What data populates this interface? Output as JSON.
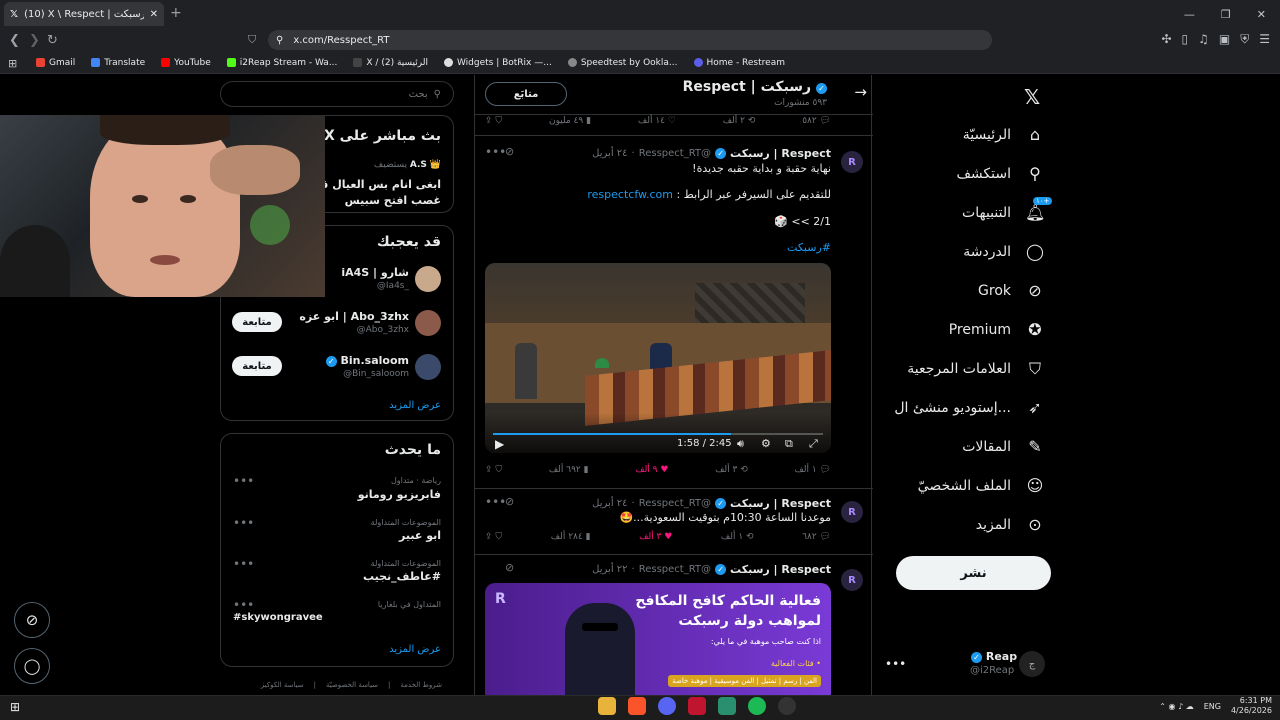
{
  "browser": {
    "tab_title": "(10) X \\ Respect | رسبكت (@Resp",
    "url": "x.com/Resspect_RT",
    "bookmarks": [
      "Gmail",
      "Translate",
      "YouTube",
      "i2Reap Stream - Wa...",
      "X / الرئيسية (2)",
      "Widgets | BotRix —...",
      "Speedtest by Ookla...",
      "Home - Restream"
    ]
  },
  "nav": {
    "home": "الرئيسيّة",
    "explore": "استكشف",
    "notifications": "التنبيهات",
    "notif_badge": "١٠+",
    "chat": "الدردشة",
    "grok": "Grok",
    "premium": "Premium",
    "bookmarks": "العلامات المرجعية",
    "studio": "إستوديو منشئ ال...",
    "articles": "المقالات",
    "profile": "الملف الشخصيّ",
    "more": "المزيد",
    "post": "نشر",
    "account_name": "Reap",
    "account_handle": "@i2Reap"
  },
  "profile": {
    "name": "Respect | رسبكت",
    "post_count": "٥٩٣ منشورات",
    "follow_label": "متابَع"
  },
  "tweets": [
    {
      "name": "Respect | رسبكت",
      "handle": "@Resspect_RT",
      "date": "٢٤ أبريل",
      "line1": "نهاية حقبة و بداية حقبه جديدة!",
      "line2": "للتقديم على السيرفر عبر الرابط :",
      "link": "respectcfw.com",
      "line3": "2/1 >> 🎲",
      "hashtag": "#رسبكت",
      "video_time": "1:58 / 2:45",
      "replies": "١ ألف",
      "reposts": "٣ ألف",
      "likes": "٩ ألف",
      "views": "٦٩٢ ألف"
    },
    {
      "name": "Respect | رسبكت",
      "handle": "@Resspect_RT",
      "date": "٢٤ أبريل",
      "line1": "موعدنا الساعة 10:30م بتوقيت السعودية...🤩",
      "replies": "٦٨٢",
      "reposts": "١ ألف",
      "likes": "٣ ألف",
      "views": "٢٨٤ ألف"
    },
    {
      "name": "Respect | رسبكت",
      "handle": "@Resspect_RT",
      "date": "٢٢ أبريل",
      "banner_title1": "فعالية الحاكم كافح المكافح",
      "banner_title2": "لمواهب دولة رسبكت",
      "banner_sub": "اذا كنت صاحب موهبة في ما يلي:",
      "banner_item": "• فئات الفعالية",
      "banner_tags": "الفن | رسم | تمثيل | الفن موسيقية | موهبة خاصة"
    }
  ],
  "top_actions": {
    "replies": "٥٨٢",
    "reposts": "٢ ألف",
    "likes": "١٤ ألف",
    "views": "٤٩ مليون"
  },
  "search": {
    "placeholder": "بحث"
  },
  "live": {
    "title": "بث مباشر على X",
    "host": "A.S",
    "host_label": "يستضيف",
    "text1": "ابغى انام بس العيال قالوا",
    "text2": "غصب افتح سبيس"
  },
  "suggest": {
    "title": "قد يعجبك",
    "users": [
      {
        "name": "iA4S | شارو",
        "handle": "@Ia4s_"
      },
      {
        "name": "ابو عزه | Abo_3zhx",
        "handle": "@Abo_3zhx",
        "btn": "متابعة"
      },
      {
        "name": "Bin.saloom",
        "handle": "@Bin_salooom",
        "btn": "متابعة"
      }
    ],
    "show_more": "عرض المزيد"
  },
  "trends": {
    "title": "ما يحدث",
    "items": [
      {
        "cat": "رياضة · متداول",
        "name": "فابريزيو رومانو"
      },
      {
        "cat": "الموضوعات المتداولة",
        "name": "ابو عبير"
      },
      {
        "cat": "الموضوعات المتداولة",
        "name": "#عاطف_نجيب"
      },
      {
        "cat": "المتداول في بلغاريا",
        "name": "#skywongravee"
      }
    ],
    "show_more": "عرض المزيد"
  },
  "footer": [
    "شروط الخدمة",
    "سياسة الخصوصيّة",
    "سياسة الكوكيز"
  ],
  "system": {
    "lang": "ENG",
    "time": "6:31 PM",
    "date": "4/26/2026"
  }
}
